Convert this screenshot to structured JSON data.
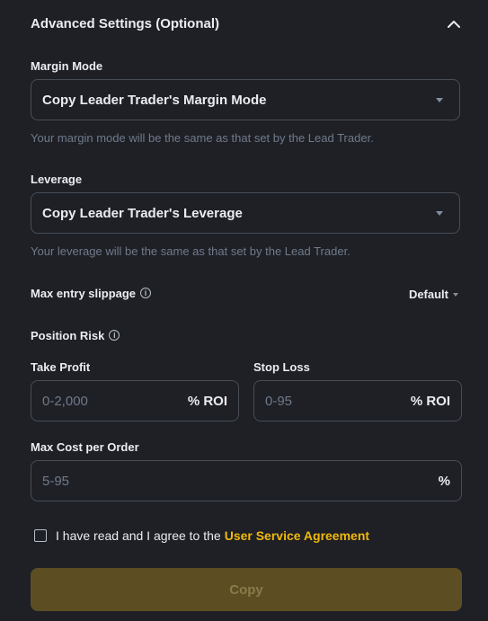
{
  "header": {
    "title": "Advanced Settings (Optional)",
    "collapse_icon": "chevron-up-icon"
  },
  "margin_mode": {
    "label": "Margin Mode",
    "value": "Copy Leader Trader's Margin Mode",
    "helper": "Your margin mode will be the same as that set by the Lead Trader."
  },
  "leverage": {
    "label": "Leverage",
    "value": "Copy Leader Trader's Leverage",
    "helper": "Your leverage will be the same as that set by the Lead Trader."
  },
  "slippage": {
    "label": "Max entry slippage",
    "value": "Default",
    "info_icon": "i"
  },
  "position_risk": {
    "label": "Position Risk",
    "info_icon": "i"
  },
  "take_profit": {
    "label": "Take Profit",
    "placeholder": "0-2,000",
    "value": "",
    "unit": "% ROI"
  },
  "stop_loss": {
    "label": "Stop Loss",
    "placeholder": "0-95",
    "value": "",
    "unit": "% ROI"
  },
  "max_cost": {
    "label": "Max Cost per Order",
    "placeholder": "5-95",
    "value": "",
    "unit": "%"
  },
  "agreement": {
    "checked": false,
    "text": "I have read and I agree to the",
    "link": "User Service Agreement"
  },
  "actions": {
    "copy_label": "Copy"
  },
  "colors": {
    "background": "#1e2026",
    "border": "#474d57",
    "accent": "#f0b90b",
    "button_disabled_bg": "#5c4e22",
    "button_disabled_text": "#8a7b4a",
    "muted_text": "#707a8a"
  }
}
